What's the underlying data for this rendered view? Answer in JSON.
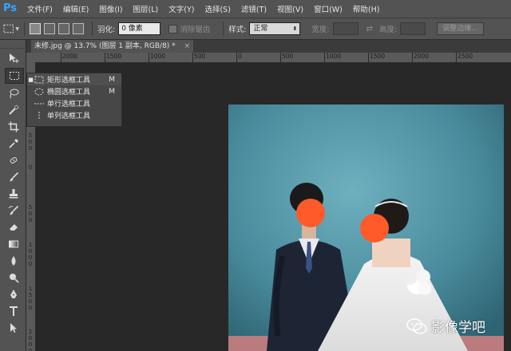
{
  "app": {
    "logo": "Ps"
  },
  "menu": [
    "文件(F)",
    "编辑(E)",
    "图像(I)",
    "图层(L)",
    "文字(Y)",
    "选择(S)",
    "滤镜(T)",
    "视图(V)",
    "窗口(W)",
    "帮助(H)"
  ],
  "options": {
    "feather_label": "羽化:",
    "feather_value": "0 像素",
    "antialias_label": "消除锯齿",
    "style_label": "样式:",
    "style_value": "正常",
    "width_label": "宽度:",
    "height_label": "高度:",
    "refine_label": "调整边缘..."
  },
  "document": {
    "tab_title": "未修.jpg @ 13.7% (图层 1 副本, RGB/8) *",
    "close_glyph": "×"
  },
  "ruler": {
    "h_labels": [
      "2000",
      "1500",
      "1000",
      "500",
      "0",
      "500",
      "1000",
      "1500",
      "2000",
      "2500"
    ],
    "v_labels": [
      "5 0 0",
      "0",
      "5 0 0",
      "1 0 0 0",
      "1 5 0 0",
      "2 0 0 0"
    ]
  },
  "flyout": {
    "items": [
      {
        "label": "矩形选框工具",
        "shortcut": "M",
        "icon": "rect-marquee-icon",
        "selected": true
      },
      {
        "label": "椭圆选框工具",
        "shortcut": "M",
        "icon": "ellipse-marquee-icon",
        "selected": false
      },
      {
        "label": "单行选框工具",
        "shortcut": "",
        "icon": "single-row-marquee-icon",
        "selected": false
      },
      {
        "label": "单列选框工具",
        "shortcut": "",
        "icon": "single-column-marquee-icon",
        "selected": false
      }
    ],
    "bullet": "■"
  },
  "tools": [
    "move-tool-icon",
    "marquee-tool-icon",
    "lasso-tool-icon",
    "quick-select-tool-icon",
    "crop-tool-icon",
    "eyedropper-tool-icon",
    "healing-brush-tool-icon",
    "brush-tool-icon",
    "clone-stamp-tool-icon",
    "history-brush-tool-icon",
    "eraser-tool-icon",
    "gradient-tool-icon",
    "blur-tool-icon",
    "dodge-tool-icon",
    "pen-tool-icon",
    "type-tool-icon",
    "path-select-tool-icon"
  ],
  "watermark": {
    "text": "影像学吧"
  },
  "colors": {
    "accent": "#31a8ff",
    "panel": "#535353",
    "workspace": "#282828"
  }
}
